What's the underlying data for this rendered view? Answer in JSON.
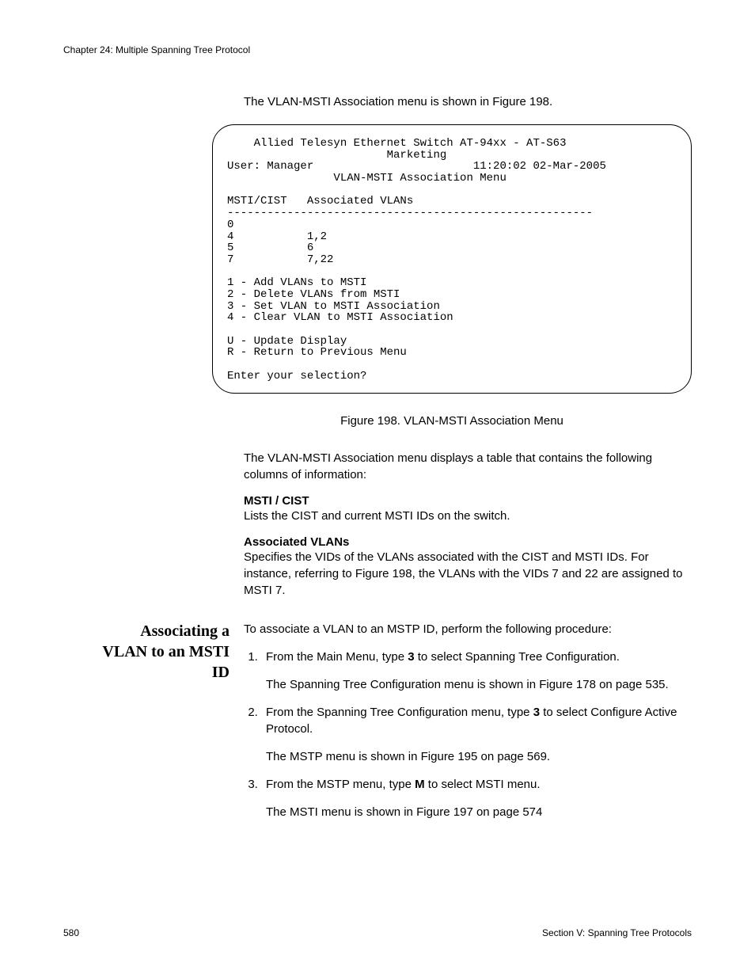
{
  "header": "Chapter 24: Multiple Spanning Tree Protocol",
  "intro": "The VLAN-MSTI Association menu is shown in Figure 198.",
  "terminal": {
    "title1": "Allied Telesyn Ethernet Switch AT-94xx - AT-S63",
    "title2": "Marketing",
    "userline_left": "User: Manager",
    "userline_right": "11:20:02 02-Mar-2005",
    "menuname": "VLAN-MSTI Association Menu",
    "colhead": "MSTI/CIST   Associated VLANs",
    "divider": "-------------------------------------------------------",
    "rows": [
      "0",
      "4           1,2",
      "5           6",
      "7           7,22"
    ],
    "options": [
      "1 - Add VLANs to MSTI",
      "2 - Delete VLANs from MSTI",
      "3 - Set VLAN to MSTI Association",
      "4 - Clear VLAN to MSTI Association"
    ],
    "nav": [
      "U - Update Display",
      "R - Return to Previous Menu"
    ],
    "prompt": "Enter your selection?"
  },
  "figcap": "Figure 198. VLAN-MSTI Association Menu",
  "after_fig": "The VLAN-MSTI Association menu displays a table that contains the following columns of information:",
  "defs": [
    {
      "term": "MSTI / CIST",
      "body": "Lists the CIST and current MSTI IDs on the switch."
    },
    {
      "term": "Associated VLANs",
      "body": "Specifies the VIDs of the VLANs associated with the CIST and MSTI IDs. For instance, referring to Figure 198, the VLANs with the VIDs 7 and 22 are assigned to MSTI 7."
    }
  ],
  "side_heading": "Associating a VLAN to an MSTI ID",
  "proc_intro": "To associate a VLAN to an MSTP ID, perform the following procedure:",
  "steps": [
    {
      "pre": "From the Main Menu, type ",
      "bold": "3",
      "post": " to select Spanning Tree Configuration.",
      "sub": "The Spanning Tree Configuration menu is shown in Figure 178 on page 535."
    },
    {
      "pre": "From the Spanning Tree Configuration menu, type ",
      "bold": "3",
      "post": " to select Configure Active Protocol.",
      "sub": "The MSTP menu is shown in Figure 195 on page 569."
    },
    {
      "pre": "From the MSTP menu, type ",
      "bold": "M",
      "post": " to select MSTI menu.",
      "sub": "The MSTI menu is shown in Figure 197 on page 574"
    }
  ],
  "footer": {
    "page": "580",
    "section": "Section V: Spanning Tree Protocols"
  }
}
